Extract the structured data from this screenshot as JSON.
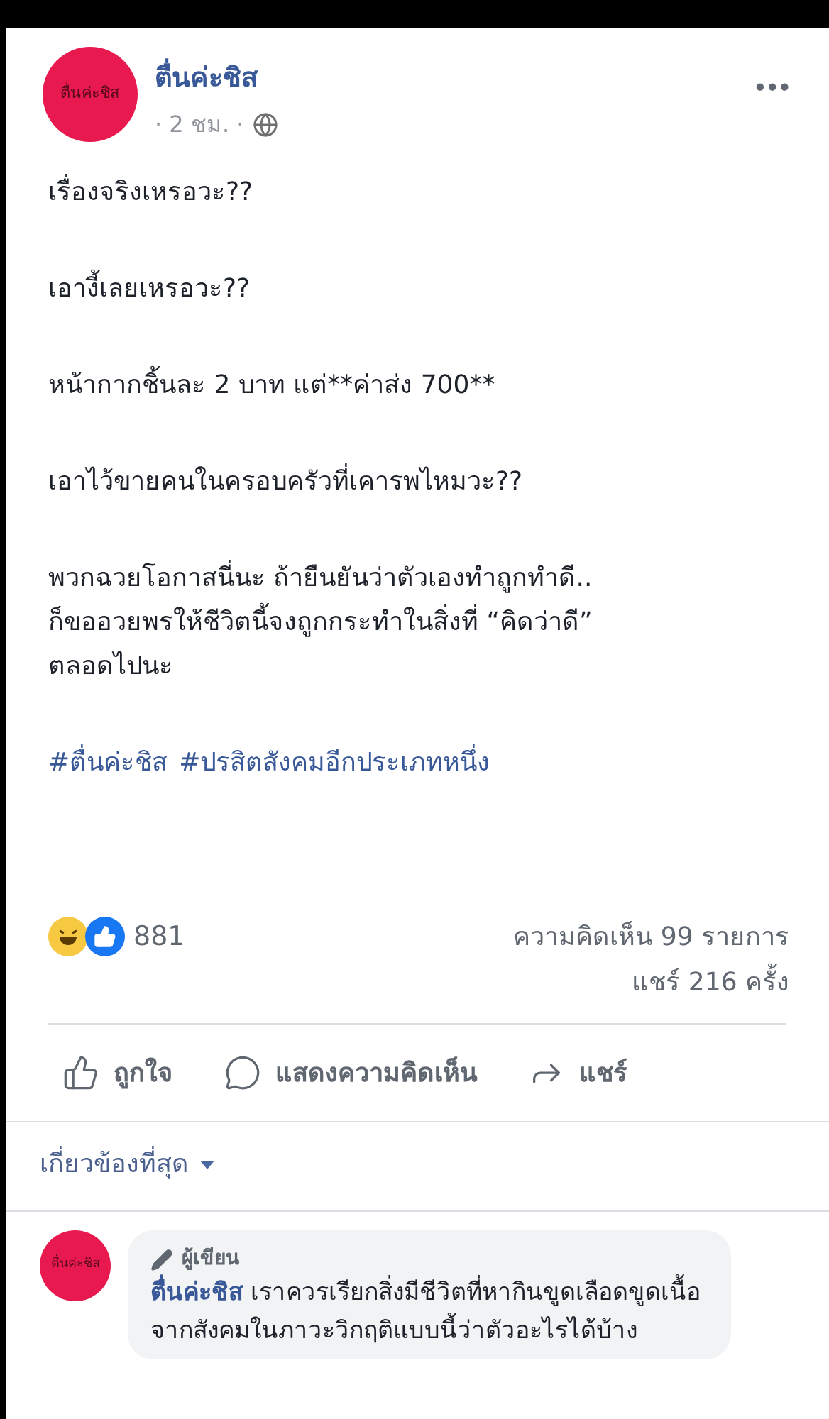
{
  "post": {
    "avatar_label": "ตื่นค่ะชิส",
    "author": "ตื่นค่ะชิส",
    "time": "· 2 ชม. ·",
    "more": "•••",
    "paragraphs": [
      "เรื่องจริงเหรอวะ??",
      "เอางี้เลยเหรอวะ??",
      "หน้ากากชิ้นละ 2 บาท แต่**ค่าส่ง 700**",
      "เอาไว้ขายคนในครอบครัวที่เคารพไหมวะ??",
      "พวกฉวยโอกาสนี่นะ ถ้ายืนยันว่าตัวเองทำถูกทำดี..\nก็ขออวยพรให้ชีวิตนี้จงถูกกระทำในสิ่งที่ “คิดว่าดี”\nตลอดไปนะ"
    ],
    "hashtags": [
      "#ตื่นค่ะชิส",
      "#ปรสิตสังคมอีกประเภทหนึ่ง"
    ]
  },
  "reactions": {
    "count": "881",
    "comments": "ความคิดเห็น 99 รายการ",
    "shares": "แชร์ 216 ครั้ง"
  },
  "actions": [
    {
      "kind": "like",
      "label": "ถูกใจ"
    },
    {
      "kind": "comment",
      "label": "แสดงความคิดเห็น"
    },
    {
      "kind": "share",
      "label": "แชร์"
    }
  ],
  "sort": {
    "label": "เกี่ยวข้องที่สุด"
  },
  "comments": [
    {
      "avatar_label": "ตื่นค่ะชิส",
      "badge": "ผู้เขียน",
      "author": "ตื่นค่ะชิส",
      "text": "เราควรเรียกสิ่งมีชีวิตที่หากินขูดเลือดขูดเนื้อจากสังคมในภาวะวิกฤติแบบนี้ว่าตัวอะไรได้บ้าง"
    }
  ]
}
